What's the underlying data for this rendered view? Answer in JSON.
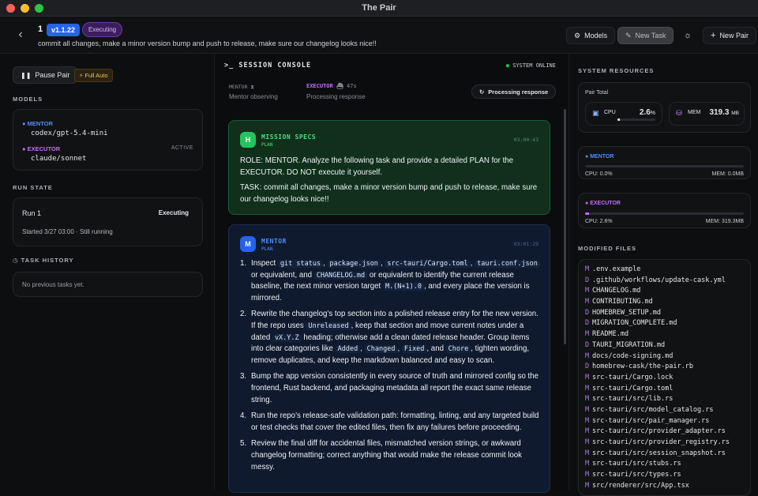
{
  "window": {
    "title": "The Pair"
  },
  "header": {
    "task_number": "1",
    "version": "v1.1.22",
    "status": "Executing",
    "task_text": "commit all changes, make a minor version bump and push to release, make sure our changelog looks nice!!",
    "models_label": "Models",
    "new_task_label": "New Task",
    "new_pair_label": "New Pair"
  },
  "left": {
    "pause_label": "Pause Pair",
    "full_auto_label": "Full Auto",
    "models_heading": "MODELS",
    "mentor_role": "MENTOR",
    "mentor_model": "codex/gpt-5.4-mini",
    "executor_role": "EXECUTOR",
    "executor_model": "claude/sonnet",
    "active_label": "ACTIVE",
    "run_state_heading": "RUN STATE",
    "run_name": "Run 1",
    "run_status": "Executing",
    "run_started": "Started 3/27 03:00 · Still running",
    "history_heading": "TASK HISTORY",
    "history_empty": "No previous tasks yet."
  },
  "console": {
    "title": "SESSION CONSOLE",
    "online": "SYSTEM ONLINE",
    "mentor_label": "MENTOR",
    "mentor_state": "Mentor observing",
    "executor_label": "EXECUTOR",
    "executor_time": "47s",
    "executor_state": "Processing response",
    "processing_label": "Processing response"
  },
  "messages": {
    "specs": {
      "avatar": "H",
      "title": "MISSION SPECS",
      "tag": "PLAN",
      "time": "03:00:43",
      "p1": "ROLE: MENTOR. Analyze the following task and provide a detailed PLAN for the EXECUTOR. DO NOT execute it yourself.",
      "p2": "TASK: commit all changes, make a minor version bump and push to release, make sure our changelog looks nice!!"
    },
    "mentor": {
      "avatar": "M",
      "title": "MENTOR",
      "tag": "PLAN",
      "time": "03:01:29",
      "item1": {
        "t1": "Inspect ",
        "c1": "git status",
        "t2": ", ",
        "c2": "package.json",
        "t3": ", ",
        "c3": "src-tauri/Cargo.toml",
        "t4": ", ",
        "c4": "tauri.conf.json",
        "t5": " or equivalent, and ",
        "c5": "CHANGELOG.md",
        "t6": " or equivalent to identify the current release baseline, the next minor version target ",
        "c6": "M.(N+1).0",
        "t7": ", and every place the version is mirrored."
      },
      "item2": {
        "t1": "Rewrite the changelog’s top section into a polished release entry for the new version. If the repo uses ",
        "c1": "Unreleased",
        "t2": ", keep that section and move current notes under a dated ",
        "c2": "vX.Y.Z",
        "t3": " heading; otherwise add a clean dated release header. Group items into clear categories like ",
        "c3": "Added",
        "t4": ", ",
        "c4": "Changed",
        "t5": ", ",
        "c5": "Fixed",
        "t6": ", and ",
        "c6": "Chore",
        "t7": ", tighten wording, remove duplicates, and keep the markdown balanced and easy to scan."
      },
      "item3": "Bump the app version consistently in every source of truth and mirrored config so the frontend, Rust backend, and packaging metadata all report the exact same release string.",
      "item4": "Run the repo’s release-safe validation path: formatting, linting, and any targeted build or test checks that cover the edited files, then fix any failures before proceeding.",
      "item5": "Review the final diff for accidental files, mismatched version strings, or awkward changelog formatting; correct anything that would make the release commit look messy."
    }
  },
  "resources": {
    "heading": "SYSTEM RESOURCES",
    "pair_total": "Pair Total",
    "cpu_label": "CPU",
    "cpu_value": "2.6",
    "cpu_unit": "%",
    "cpu_fraction": 0.026,
    "mem_label": "MEM",
    "mem_value": "319.3",
    "mem_unit": "MB",
    "mentor_label": "MENTOR",
    "mentor_cpu": "CPU: 0.0%",
    "mentor_mem": "MEM: 0.0MB",
    "executor_label": "EXECUTOR",
    "executor_cpu": "CPU: 2.6%",
    "executor_mem": "MEM: 319.3MB"
  },
  "modified": {
    "heading": "MODIFIED FILES",
    "files": [
      {
        "s": "M",
        "p": ".env.example"
      },
      {
        "s": "D",
        "p": ".github/workflows/update-cask.yml"
      },
      {
        "s": "M",
        "p": "CHANGELOG.md"
      },
      {
        "s": "M",
        "p": "CONTRIBUTING.md"
      },
      {
        "s": "D",
        "p": "HOMEBREW_SETUP.md"
      },
      {
        "s": "D",
        "p": "MIGRATION_COMPLETE.md"
      },
      {
        "s": "M",
        "p": "README.md"
      },
      {
        "s": "D",
        "p": "TAURI_MIGRATION.md"
      },
      {
        "s": "M",
        "p": "docs/code-signing.md"
      },
      {
        "s": "D",
        "p": "homebrew-cask/the-pair.rb"
      },
      {
        "s": "M",
        "p": "src-tauri/Cargo.lock"
      },
      {
        "s": "M",
        "p": "src-tauri/Cargo.toml"
      },
      {
        "s": "M",
        "p": "src-tauri/src/lib.rs"
      },
      {
        "s": "M",
        "p": "src-tauri/src/model_catalog.rs"
      },
      {
        "s": "M",
        "p": "src-tauri/src/pair_manager.rs"
      },
      {
        "s": "M",
        "p": "src-tauri/src/provider_adapter.rs"
      },
      {
        "s": "M",
        "p": "src-tauri/src/provider_registry.rs"
      },
      {
        "s": "M",
        "p": "src-tauri/src/session_snapshot.rs"
      },
      {
        "s": "M",
        "p": "src-tauri/src/stubs.rs"
      },
      {
        "s": "M",
        "p": "src-tauri/src/types.rs"
      },
      {
        "s": "M",
        "p": "src/renderer/src/App.tsx"
      }
    ]
  },
  "colors": {
    "accent": "#2563eb",
    "mentor": "#4c8dff",
    "executor": "#c26bff",
    "online": "#22c55e",
    "specs_bg": "#10301c",
    "mentor_bg": "#0f1a2e"
  }
}
